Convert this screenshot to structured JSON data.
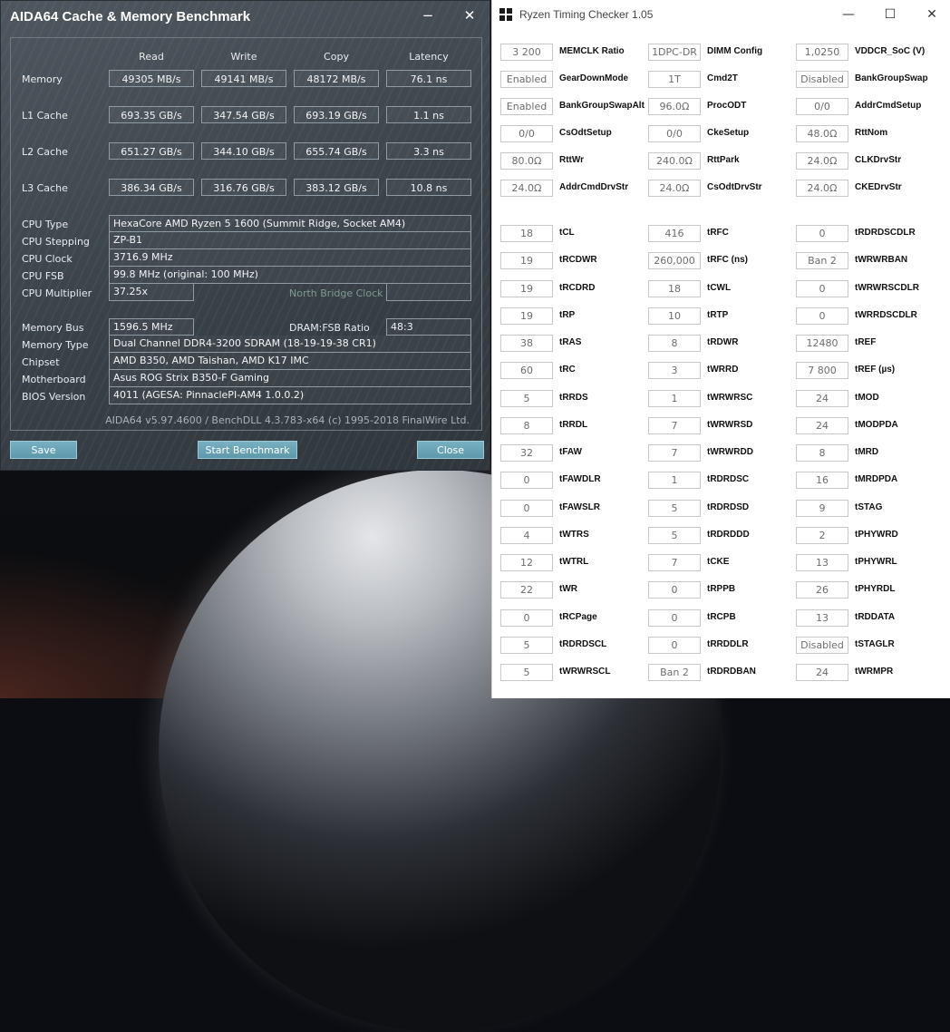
{
  "aida": {
    "title": "AIDA64 Cache & Memory Benchmark",
    "minimize_glyph": "−",
    "close_glyph": "✕",
    "columns": [
      "Read",
      "Write",
      "Copy",
      "Latency"
    ],
    "bench_rows": [
      {
        "label": "Memory",
        "values": [
          "49305 MB/s",
          "49141 MB/s",
          "48172 MB/s",
          "76.1 ns"
        ]
      },
      {
        "label": "L1 Cache",
        "values": [
          "693.35 GB/s",
          "347.54 GB/s",
          "693.19 GB/s",
          "1.1 ns"
        ]
      },
      {
        "label": "L2 Cache",
        "values": [
          "651.27 GB/s",
          "344.10 GB/s",
          "655.74 GB/s",
          "3.3 ns"
        ]
      },
      {
        "label": "L3 Cache",
        "values": [
          "386.34 GB/s",
          "316.76 GB/s",
          "383.12 GB/s",
          "10.8 ns"
        ]
      }
    ],
    "cpu_info": [
      {
        "label": "CPU Type",
        "value": "HexaCore AMD Ryzen 5 1600  (Summit Ridge, Socket AM4)"
      },
      {
        "label": "CPU Stepping",
        "value": "ZP-B1"
      },
      {
        "label": "CPU Clock",
        "value": "3716.9 MHz"
      },
      {
        "label": "CPU FSB",
        "value": "99.8 MHz  (original: 100 MHz)"
      },
      {
        "label": "CPU Multiplier",
        "value": "37.25x"
      }
    ],
    "north_bridge_label": "North Bridge Clock",
    "north_bridge_value": "",
    "memory_bus_label": "Memory Bus",
    "memory_bus_value": "1596.5 MHz",
    "dram_ratio_label": "DRAM:FSB Ratio",
    "dram_ratio_value": "48:3",
    "sys_info": [
      {
        "label": "Memory Type",
        "value": "Dual Channel DDR4-3200 SDRAM  (18-19-19-38 CR1)"
      },
      {
        "label": "Chipset",
        "value": "AMD B350, AMD Taishan, AMD K17 IMC"
      },
      {
        "label": "Motherboard",
        "value": "Asus ROG Strix B350-F Gaming"
      },
      {
        "label": "BIOS Version",
        "value": "4011  (AGESA: PinnaclePI-AM4 1.0.0.2)"
      }
    ],
    "footer": "AIDA64 v5.97.4600 / BenchDLL 4.3.783-x64  (c) 1995-2018 FinalWire Ltd.",
    "buttons": {
      "save": "Save",
      "start": "Start Benchmark",
      "close": "Close"
    }
  },
  "rtc": {
    "title": "Ryzen Timing Checker 1.05",
    "controls": {
      "minimize": "—",
      "maximize": "☐",
      "close": "✕"
    },
    "columns": [
      [
        {
          "value": "3 200",
          "label": "MEMCLK Ratio"
        },
        {
          "value": "Enabled",
          "label": "GearDownMode"
        },
        {
          "value": "Enabled",
          "label": "BankGroupSwapAlt"
        },
        {
          "value": "0/0",
          "label": "CsOdtSetup"
        },
        {
          "value": "80.0Ω",
          "label": "RttWr"
        },
        {
          "value": "24.0Ω",
          "label": "AddrCmdDrvStr"
        },
        {
          "value": "18",
          "label": "tCL"
        },
        {
          "value": "19",
          "label": "tRCDWR"
        },
        {
          "value": "19",
          "label": "tRCDRD"
        },
        {
          "value": "19",
          "label": "tRP"
        },
        {
          "value": "38",
          "label": "tRAS"
        },
        {
          "value": "60",
          "label": "tRC"
        },
        {
          "value": "5",
          "label": "tRRDS"
        },
        {
          "value": "8",
          "label": "tRRDL"
        },
        {
          "value": "32",
          "label": "tFAW"
        },
        {
          "value": "0",
          "label": "tFAWDLR"
        },
        {
          "value": "0",
          "label": "tFAWSLR"
        },
        {
          "value": "4",
          "label": "tWTRS"
        },
        {
          "value": "12",
          "label": "tWTRL"
        },
        {
          "value": "22",
          "label": "tWR"
        },
        {
          "value": "0",
          "label": "tRCPage"
        },
        {
          "value": "5",
          "label": "tRDRDSCL"
        },
        {
          "value": "5",
          "label": "tWRWRSCL"
        }
      ],
      [
        {
          "value": "1DPC-DR",
          "label": "DIMM Config"
        },
        {
          "value": "1T",
          "label": "Cmd2T"
        },
        {
          "value": "96.0Ω",
          "label": "ProcODT"
        },
        {
          "value": "0/0",
          "label": "CkeSetup"
        },
        {
          "value": "240.0Ω",
          "label": "RttPark"
        },
        {
          "value": "24.0Ω",
          "label": "CsOdtDrvStr"
        },
        {
          "value": "416",
          "label": "tRFC"
        },
        {
          "value": "260,000",
          "label": "tRFC (ns)"
        },
        {
          "value": "18",
          "label": "tCWL"
        },
        {
          "value": "10",
          "label": "tRTP"
        },
        {
          "value": "8",
          "label": "tRDWR"
        },
        {
          "value": "3",
          "label": "tWRRD"
        },
        {
          "value": "1",
          "label": "tWRWRSC"
        },
        {
          "value": "7",
          "label": "tWRWRSD"
        },
        {
          "value": "7",
          "label": "tWRWRDD"
        },
        {
          "value": "1",
          "label": "tRDRDSC"
        },
        {
          "value": "5",
          "label": "tRDRDSD"
        },
        {
          "value": "5",
          "label": "tRDRDDD"
        },
        {
          "value": "7",
          "label": "tCKE"
        },
        {
          "value": "0",
          "label": "tRPPB"
        },
        {
          "value": "0",
          "label": "tRCPB"
        },
        {
          "value": "0",
          "label": "tRRDDLR"
        },
        {
          "value": "Ban 2",
          "label": "tRDRDBAN"
        }
      ],
      [
        {
          "value": "1,0250",
          "label": "VDDCR_SoC (V)"
        },
        {
          "value": "Disabled",
          "label": "BankGroupSwap"
        },
        {
          "value": "0/0",
          "label": "AddrCmdSetup"
        },
        {
          "value": "48.0Ω",
          "label": "RttNom"
        },
        {
          "value": "24.0Ω",
          "label": "CLKDrvStr"
        },
        {
          "value": "24.0Ω",
          "label": "CKEDrvStr"
        },
        {
          "value": "0",
          "label": "tRDRDSCDLR"
        },
        {
          "value": "Ban 2",
          "label": "tWRWRBAN"
        },
        {
          "value": "0",
          "label": "tWRWRSCDLR"
        },
        {
          "value": "0",
          "label": "tWRRDSCDLR"
        },
        {
          "value": "12480",
          "label": "tREF"
        },
        {
          "value": "7 800",
          "label": "tREF (µs)"
        },
        {
          "value": "24",
          "label": "tMOD"
        },
        {
          "value": "24",
          "label": "tMODPDA"
        },
        {
          "value": "8",
          "label": "tMRD"
        },
        {
          "value": "16",
          "label": "tMRDPDA"
        },
        {
          "value": "9",
          "label": "tSTAG"
        },
        {
          "value": "2",
          "label": "tPHYWRD"
        },
        {
          "value": "13",
          "label": "tPHYWRL"
        },
        {
          "value": "26",
          "label": "tPHYRDL"
        },
        {
          "value": "13",
          "label": "tRDDATA"
        },
        {
          "value": "Disabled",
          "label": "tSTAGLR"
        },
        {
          "value": "24",
          "label": "tWRMPR"
        }
      ]
    ]
  }
}
